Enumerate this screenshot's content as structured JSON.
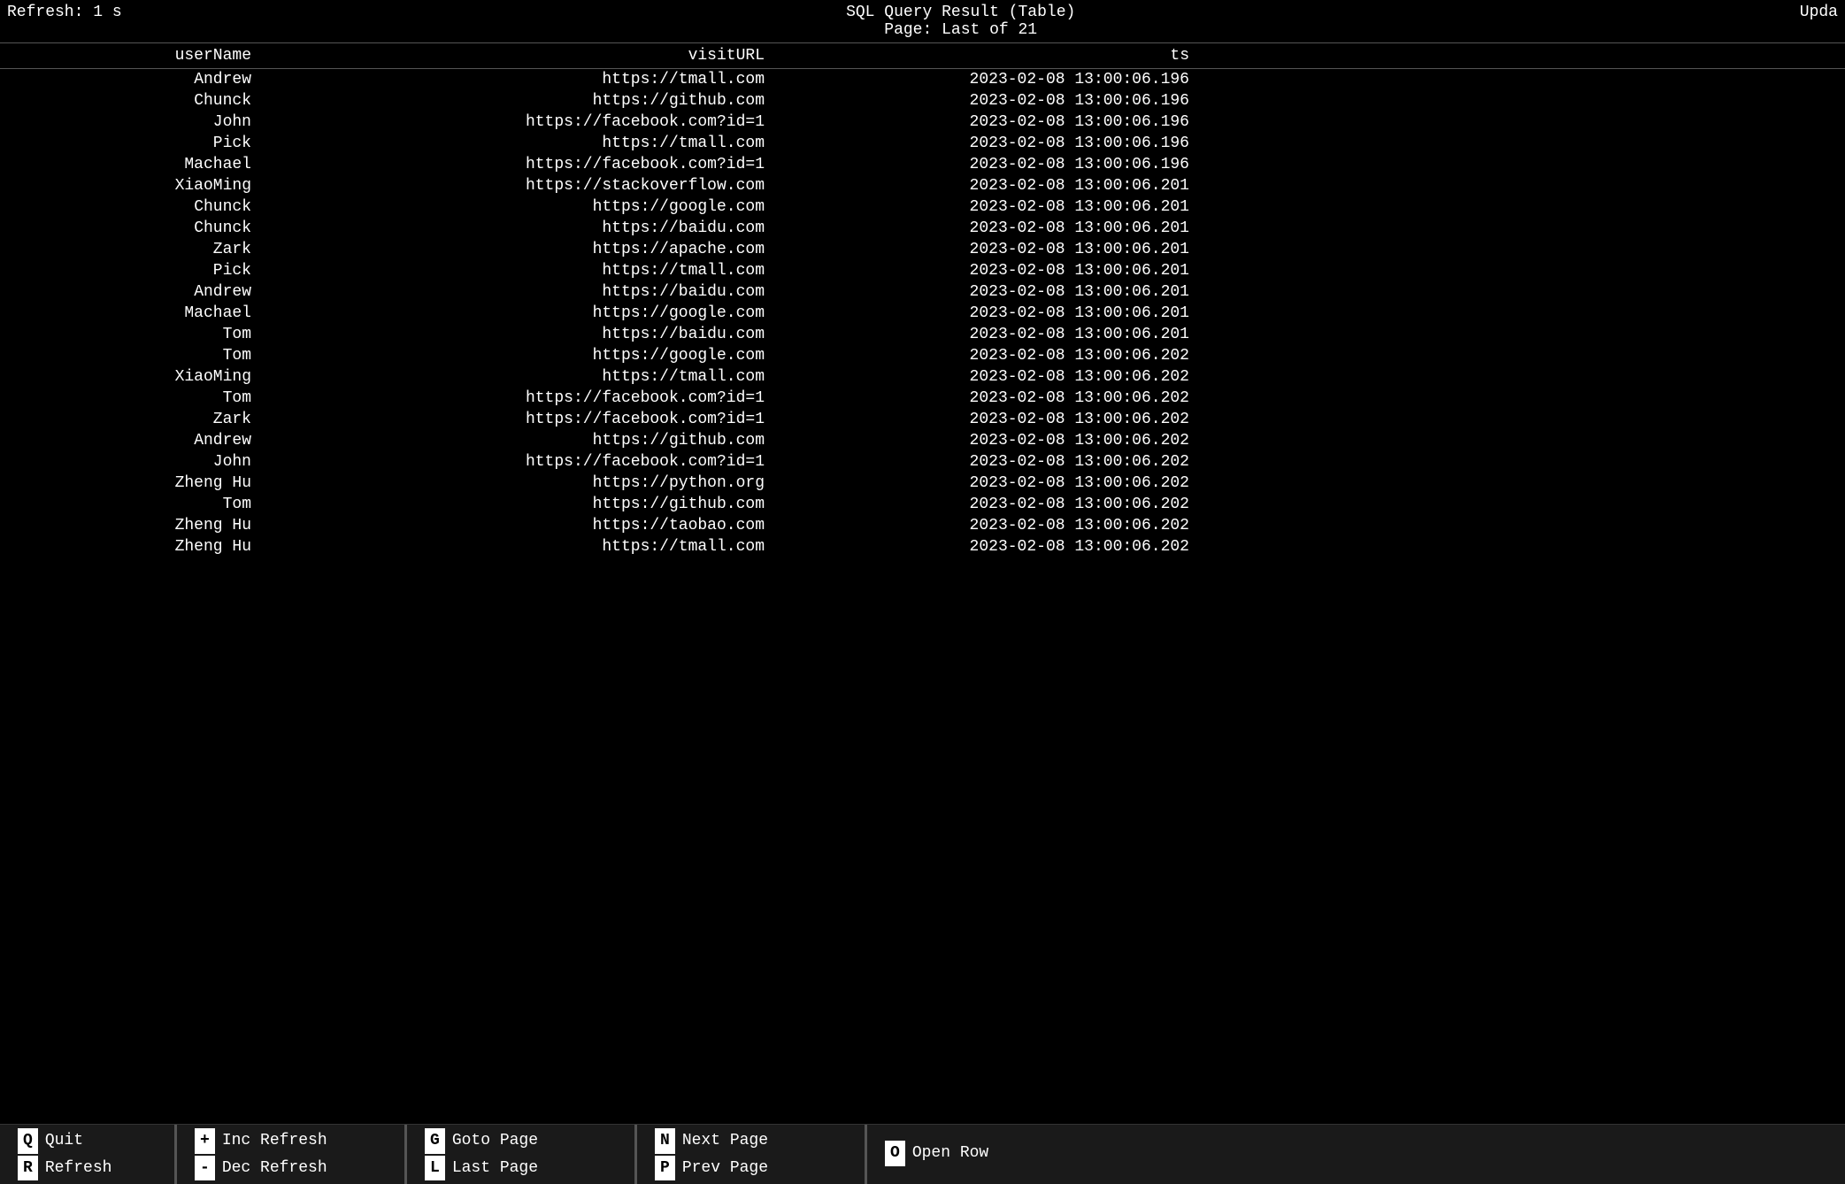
{
  "header": {
    "title": "SQL Query Result (Table)",
    "refresh_label": "Refresh: 1 s",
    "page_label": "Page: Last of 21",
    "update_label": "Upda"
  },
  "table": {
    "columns": [
      "userName",
      "visitURL",
      "ts"
    ],
    "rows": [
      [
        "Andrew",
        "https://tmall.com",
        "2023-02-08 13:00:06.196"
      ],
      [
        "Chunck",
        "https://github.com",
        "2023-02-08 13:00:06.196"
      ],
      [
        "John",
        "https://facebook.com?id=1",
        "2023-02-08 13:00:06.196"
      ],
      [
        "Pick",
        "https://tmall.com",
        "2023-02-08 13:00:06.196"
      ],
      [
        "Machael",
        "https://facebook.com?id=1",
        "2023-02-08 13:00:06.196"
      ],
      [
        "XiaoMing",
        "https://stackoverflow.com",
        "2023-02-08 13:00:06.201"
      ],
      [
        "Chunck",
        "https://google.com",
        "2023-02-08 13:00:06.201"
      ],
      [
        "Chunck",
        "https://baidu.com",
        "2023-02-08 13:00:06.201"
      ],
      [
        "Zark",
        "https://apache.com",
        "2023-02-08 13:00:06.201"
      ],
      [
        "Pick",
        "https://tmall.com",
        "2023-02-08 13:00:06.201"
      ],
      [
        "Andrew",
        "https://baidu.com",
        "2023-02-08 13:00:06.201"
      ],
      [
        "Machael",
        "https://google.com",
        "2023-02-08 13:00:06.201"
      ],
      [
        "Tom",
        "https://baidu.com",
        "2023-02-08 13:00:06.201"
      ],
      [
        "Tom",
        "https://google.com",
        "2023-02-08 13:00:06.202"
      ],
      [
        "XiaoMing",
        "https://tmall.com",
        "2023-02-08 13:00:06.202"
      ],
      [
        "Tom",
        "https://facebook.com?id=1",
        "2023-02-08 13:00:06.202"
      ],
      [
        "Zark",
        "https://facebook.com?id=1",
        "2023-02-08 13:00:06.202"
      ],
      [
        "Andrew",
        "https://github.com",
        "2023-02-08 13:00:06.202"
      ],
      [
        "John",
        "https://facebook.com?id=1",
        "2023-02-08 13:00:06.202"
      ],
      [
        "Zheng Hu",
        "https://python.org",
        "2023-02-08 13:00:06.202"
      ],
      [
        "Tom",
        "https://github.com",
        "2023-02-08 13:00:06.202"
      ],
      [
        "Zheng Hu",
        "https://taobao.com",
        "2023-02-08 13:00:06.202"
      ],
      [
        "Zheng Hu",
        "https://tmall.com",
        "2023-02-08 13:00:06.202"
      ]
    ]
  },
  "footer": {
    "sections": [
      {
        "rows": [
          {
            "key": "Q",
            "label": "Quit"
          },
          {
            "key": "R",
            "label": "Refresh"
          }
        ]
      },
      {
        "rows": [
          {
            "key": "+",
            "label": "Inc Refresh"
          },
          {
            "key": "-",
            "label": "Dec Refresh"
          }
        ]
      },
      {
        "rows": [
          {
            "key": "G",
            "label": "Goto Page"
          },
          {
            "key": "L",
            "label": "Last Page"
          }
        ]
      },
      {
        "rows": [
          {
            "key": "N",
            "label": "Next Page"
          },
          {
            "key": "P",
            "label": "Prev Page"
          }
        ]
      },
      {
        "rows": [
          {
            "key": "O",
            "label": "Open Row"
          }
        ]
      }
    ]
  }
}
